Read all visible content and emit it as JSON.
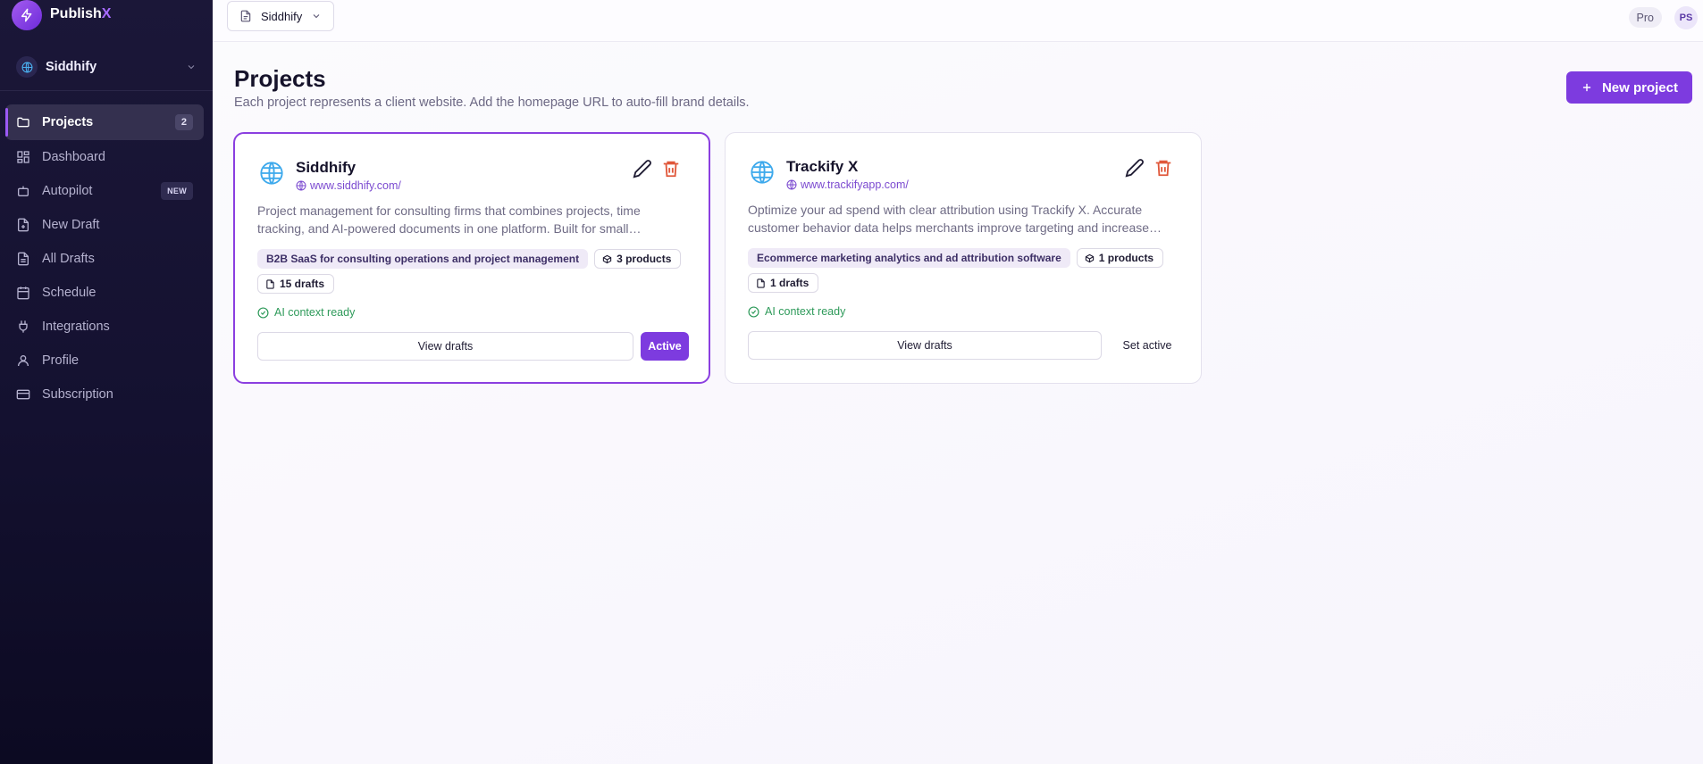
{
  "brand": {
    "name_main": "Publish",
    "name_accent": "X"
  },
  "workspace": {
    "name": "Siddhify"
  },
  "sidebar": {
    "items": [
      {
        "label": "Projects",
        "icon": "folder-icon",
        "badge": "2",
        "active": true
      },
      {
        "label": "Dashboard",
        "icon": "dashboard-icon"
      },
      {
        "label": "Autopilot",
        "icon": "bot-icon",
        "tag": "NEW"
      },
      {
        "label": "New Draft",
        "icon": "file-plus-icon"
      },
      {
        "label": "All Drafts",
        "icon": "files-icon"
      },
      {
        "label": "Schedule",
        "icon": "calendar-icon"
      },
      {
        "label": "Integrations",
        "icon": "plug-icon"
      },
      {
        "label": "Profile",
        "icon": "user-icon"
      },
      {
        "label": "Subscription",
        "icon": "credit-card-icon"
      }
    ]
  },
  "topbar": {
    "project_select": "Siddhify",
    "plan": "Pro",
    "avatar_initials": "PS"
  },
  "main": {
    "title": "Projects",
    "subtitle": "Each project represents a client website. Add the homepage URL to auto-fill brand details.",
    "new_project_label": "New project"
  },
  "projects": [
    {
      "name": "Siddhify",
      "url": "www.siddhify.com/",
      "description": "Project management for consulting firms that combines projects, time tracking, and AI-powered documents in one platform. Built for small consulting teams.",
      "category": "B2B SaaS for consulting operations and project management",
      "products": "3 products",
      "drafts": "15 drafts",
      "ai_status": "AI context ready",
      "view_label": "View drafts",
      "action_label": "Active",
      "active": true
    },
    {
      "name": "Trackify X",
      "url": "www.trackifyapp.com/",
      "description": "Optimize your ad spend with clear attribution using Trackify X. Accurate customer behavior data helps merchants improve targeting and increase returns.",
      "category": "Ecommerce marketing analytics and ad attribution software",
      "products": "1 products",
      "drafts": "1 drafts",
      "ai_status": "AI context ready",
      "view_label": "View drafts",
      "action_label": "Set active",
      "active": false
    }
  ],
  "colors": {
    "accent": "#7d3bdf",
    "sidebar_bg": "#141130",
    "success": "#2e9a5a",
    "danger": "#e0573a"
  }
}
